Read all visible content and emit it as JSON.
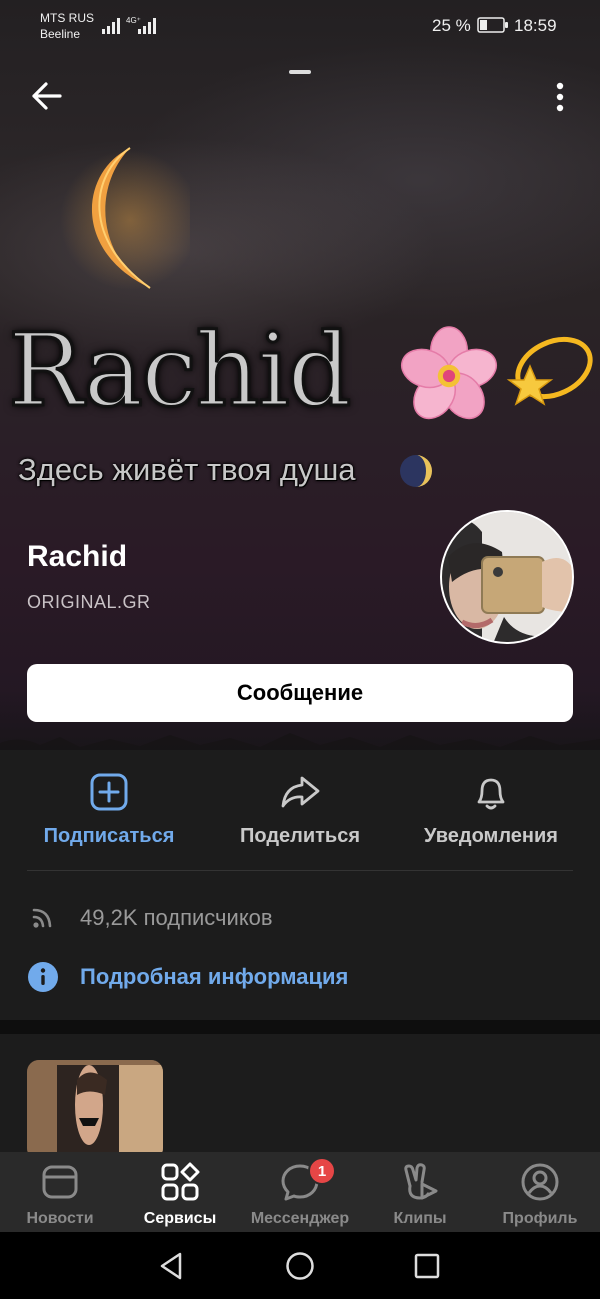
{
  "status_bar": {
    "carrier_line1": "MTS RUS",
    "carrier_line2": "Beeline",
    "network_label": "4G⁺",
    "battery_percent": "25 %",
    "battery_level": 0.25,
    "time": "18:59"
  },
  "cover": {
    "title": "Rachid",
    "subtitle": "Здесь живёт твоя душа",
    "emoji": [
      "flower-emoji",
      "dizzy-star-emoji",
      "moon-emoji"
    ]
  },
  "profile": {
    "name": "Rachid",
    "status": "ORIGINAL.GR",
    "message_button": "Сообщение"
  },
  "actions": [
    {
      "label": "Подписаться",
      "icon": "plus-square-icon",
      "accent": "#71aaeb"
    },
    {
      "label": "Поделиться",
      "icon": "share-arrow-icon"
    },
    {
      "label": "Уведомления",
      "icon": "bell-icon"
    }
  ],
  "info": {
    "followers": "49,2K подписчиков",
    "details_link": "Подробная информация"
  },
  "tabbar": {
    "items": [
      {
        "label": "Новости",
        "icon": "news-icon",
        "active": false
      },
      {
        "label": "Сервисы",
        "icon": "services-icon",
        "active": true
      },
      {
        "label": "Мессенджер",
        "icon": "messenger-icon",
        "active": false
      },
      {
        "label": "Клипы",
        "icon": "clips-icon",
        "active": false
      },
      {
        "label": "Профиль",
        "icon": "profile-icon",
        "active": false
      }
    ],
    "messenger_badge": "1"
  },
  "colors": {
    "accent": "#71aaeb",
    "badge": "#e64646",
    "background": "#1c1c1c"
  }
}
